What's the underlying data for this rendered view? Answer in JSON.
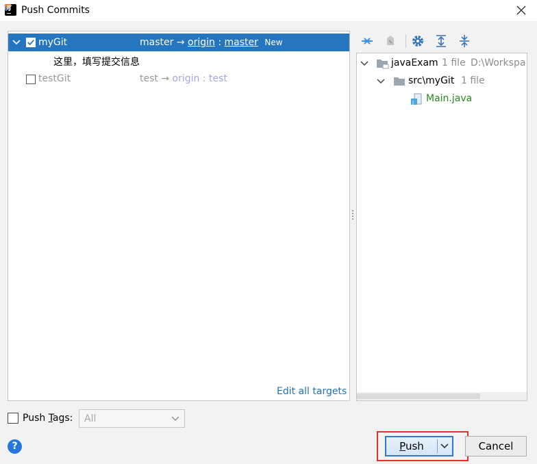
{
  "window": {
    "title": "Push Commits"
  },
  "repos": [
    {
      "name": "myGit",
      "checked": true,
      "expanded": true,
      "branch": "master",
      "arrow": "→",
      "remote": "origin",
      "sep": ":",
      "target": "master",
      "badge": "New",
      "commit_message": "这里，填写提交信息"
    },
    {
      "name": "testGit",
      "checked": false,
      "expanded": false,
      "branch": "test",
      "arrow": "→",
      "remote": "origin",
      "sep": ":",
      "target": "test"
    }
  ],
  "edit_all_targets": "Edit all targets",
  "toolbar_icons": [
    "move-changes-icon",
    "unshelve-icon",
    "settings-gear-icon",
    "expand-all-icon",
    "collapse-all-icon"
  ],
  "tree": [
    {
      "name": "javaExam",
      "count": "1 file",
      "path": "D:\\Workspa"
    },
    {
      "name": "src\\myGit",
      "count": "1 file"
    },
    {
      "name": "Main.java"
    }
  ],
  "push_tags": {
    "label_prefix": "Push ",
    "label_mnemonic": "T",
    "label_suffix": "ags:",
    "value": "All"
  },
  "buttons": {
    "push_mnemonic": "P",
    "push_rest": "ush",
    "cancel": "Cancel",
    "help": "?"
  },
  "colors": {
    "selection": "#2675bf",
    "accent": "#2e78d0",
    "link": "#2470b3",
    "file_new": "#278a1e",
    "highlight": "#e0302c"
  }
}
